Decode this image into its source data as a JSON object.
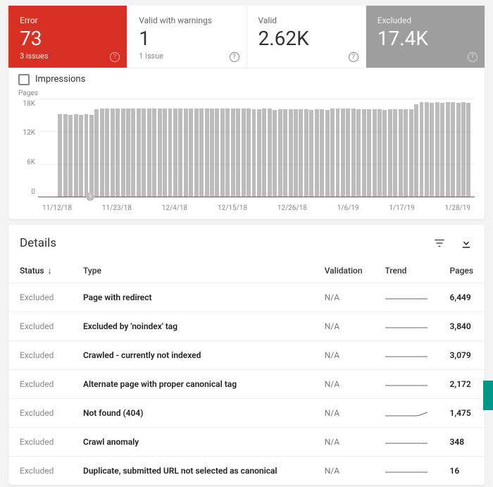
{
  "summary": {
    "tiles": [
      {
        "label": "Error",
        "value": "73",
        "sub": "3 issues"
      },
      {
        "label": "Valid with warnings",
        "value": "1",
        "sub": "1 issue"
      },
      {
        "label": "Valid",
        "value": "2.62K",
        "sub": ""
      },
      {
        "label": "Excluded",
        "value": "17.4K",
        "sub": ""
      }
    ]
  },
  "impressions_label": "Impressions",
  "chart": {
    "y_title": "Pages",
    "y_ticks": [
      "18K",
      "12K",
      "6K",
      "0"
    ],
    "x_ticks": [
      "11/12/18",
      "11/23/18",
      "12/4/18",
      "12/15/18",
      "12/26/18",
      "1/6/19",
      "1/17/19",
      "1/28/19"
    ],
    "marker_label": "1"
  },
  "chart_data": {
    "type": "bar",
    "title": "Pages",
    "xlabel": "",
    "ylabel": "Pages",
    "ylim": [
      0,
      18000
    ],
    "categories": [
      "11/12/18",
      "11/23/18",
      "12/4/18",
      "12/15/18",
      "12/26/18",
      "1/6/19",
      "1/17/19",
      "1/28/19"
    ],
    "series": [
      {
        "name": "Pages",
        "values_daily": [
          0,
          0,
          0,
          15100,
          15100,
          15000,
          15100,
          15000,
          15100,
          15000,
          16000,
          16200,
          16200,
          16100,
          16200,
          16200,
          16100,
          16200,
          16200,
          16200,
          16200,
          16100,
          16200,
          16200,
          16100,
          16200,
          16200,
          16200,
          16200,
          16200,
          16200,
          16100,
          16200,
          16200,
          16200,
          16200,
          16200,
          16200,
          16200,
          16200,
          16000,
          16000,
          16100,
          16200,
          15900,
          16000,
          16000,
          16000,
          16000,
          16000,
          16000,
          15900,
          16000,
          16000,
          15900,
          16200,
          16200,
          16200,
          16100,
          16100,
          16000,
          16000,
          16000,
          16000,
          16000,
          15900,
          16000,
          16000,
          16000,
          16000,
          16000,
          16900,
          17300,
          17300,
          17200,
          17300,
          17200,
          17300,
          17300,
          17200,
          17300,
          17200
        ]
      }
    ]
  },
  "details": {
    "title": "Details",
    "columns": {
      "status": "Status",
      "type": "Type",
      "validation": "Validation",
      "trend": "Trend",
      "pages": "Pages"
    },
    "rows": [
      {
        "status": "Excluded",
        "type": "Page with redirect",
        "validation": "N/A",
        "pages": "6,449",
        "spark": [
          10,
          10,
          10,
          10,
          10,
          10,
          10,
          10,
          10,
          10,
          10,
          10
        ]
      },
      {
        "status": "Excluded",
        "type": "Excluded by 'noindex' tag",
        "validation": "N/A",
        "pages": "3,840",
        "spark": [
          10,
          10,
          10,
          10,
          10,
          10,
          10,
          10,
          10,
          10,
          10,
          10
        ]
      },
      {
        "status": "Excluded",
        "type": "Crawled - currently not indexed",
        "validation": "N/A",
        "pages": "3,079",
        "spark": [
          10,
          10,
          10,
          10,
          10,
          10,
          10,
          10,
          10,
          10,
          10,
          10
        ]
      },
      {
        "status": "Excluded",
        "type": "Alternate page with proper canonical tag",
        "validation": "N/A",
        "pages": "2,172",
        "spark": [
          10,
          10,
          10,
          10,
          10,
          10,
          10,
          10,
          10,
          10,
          10,
          10
        ]
      },
      {
        "status": "Excluded",
        "type": "Not found (404)",
        "validation": "N/A",
        "pages": "1,475",
        "spark": [
          12,
          12,
          12,
          12,
          12,
          12,
          12,
          12,
          12,
          11,
          9,
          7
        ]
      },
      {
        "status": "Excluded",
        "type": "Crawl anomaly",
        "validation": "N/A",
        "pages": "348",
        "spark": [
          10,
          10,
          10,
          10,
          10,
          10,
          10,
          10,
          10,
          10,
          10,
          10
        ]
      },
      {
        "status": "Excluded",
        "type": "Duplicate, submitted URL not selected as canonical",
        "validation": "N/A",
        "pages": "16",
        "spark": [
          10,
          10,
          10,
          10,
          10,
          10,
          10,
          10,
          10,
          10,
          10,
          10
        ]
      }
    ]
  }
}
